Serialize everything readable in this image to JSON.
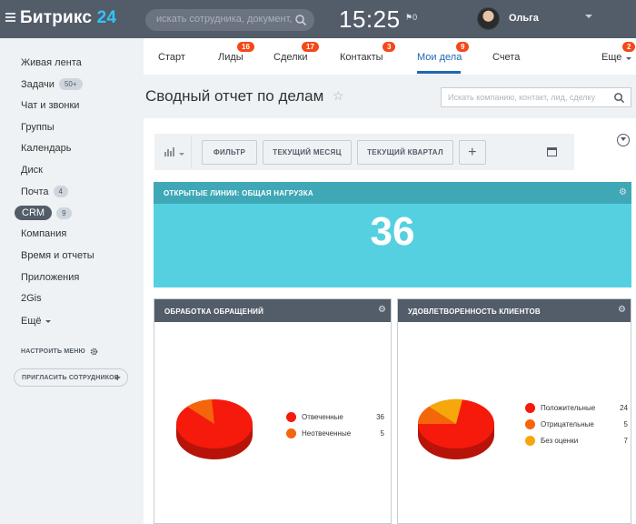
{
  "topbar": {
    "logo_text": "Битрикс",
    "logo_number": "24",
    "search_placeholder": "искать сотрудника, документ, пр",
    "time": "15:25",
    "flag_count": "0",
    "user_name": "Ольга"
  },
  "sidebar": {
    "items": [
      {
        "label": "Живая лента"
      },
      {
        "label": "Задачи",
        "counter": "50+"
      },
      {
        "label": "Чат и звонки"
      },
      {
        "label": "Группы"
      },
      {
        "label": "Календарь"
      },
      {
        "label": "Диск"
      },
      {
        "label": "Почта",
        "counter": "4"
      },
      {
        "label": "CRM",
        "counter": "9"
      },
      {
        "label": "Компания"
      },
      {
        "label": "Время и отчеты"
      },
      {
        "label": "Приложения"
      },
      {
        "label": "2Gis"
      },
      {
        "label": "Ещё"
      }
    ],
    "setup_menu": "НАСТРОИТЬ МЕНЮ",
    "invite": "ПРИГЛАСИТЬ СОТРУДНИКОВ"
  },
  "tabs": [
    {
      "label": "Старт"
    },
    {
      "label": "Лиды",
      "badge": "16"
    },
    {
      "label": "Сделки",
      "badge": "17"
    },
    {
      "label": "Контакты",
      "badge": "3"
    },
    {
      "label": "Мои дела",
      "badge": "9"
    },
    {
      "label": "Счета"
    },
    {
      "label": "Еще",
      "badge": "2"
    }
  ],
  "page": {
    "title": "Сводный отчет по делам",
    "search_placeholder": "Искать компанию, контакт, лид, сделку"
  },
  "toolbar": {
    "filter": "ФИЛЬТР",
    "current_month": "ТЕКУЩИЙ МЕСЯЦ",
    "current_quarter": "ТЕКУЩИЙ КВАРТАЛ",
    "add": "+"
  },
  "widgets": {
    "open_lines": {
      "title": "ОТКРЫТЫЕ ЛИНИИ: ОБЩАЯ НАГРУЗКА",
      "value": "36"
    },
    "requests": {
      "title": "ОБРАБОТКА ОБРАЩЕНИЙ",
      "legend": [
        {
          "label": "Отвеченные",
          "value": "36",
          "color": "#f51a0c"
        },
        {
          "label": "Неотвеченные",
          "value": "5",
          "color": "#f57c0c"
        }
      ]
    },
    "satisfaction": {
      "title": "УДОВЛЕТВОРЕННОСТЬ КЛИЕНТОВ",
      "legend": [
        {
          "label": "Положительные",
          "value": "24",
          "color": "#f51a0c"
        },
        {
          "label": "Отрицательные",
          "value": "5",
          "color": "#f57c0c"
        },
        {
          "label": "Без оценки",
          "value": "7",
          "color": "#f5a70c"
        }
      ]
    }
  },
  "colors": {
    "accent": "#2067b0",
    "topbar": "#535c69",
    "badge": "#f54819",
    "cyan": "#55d0e0"
  }
}
